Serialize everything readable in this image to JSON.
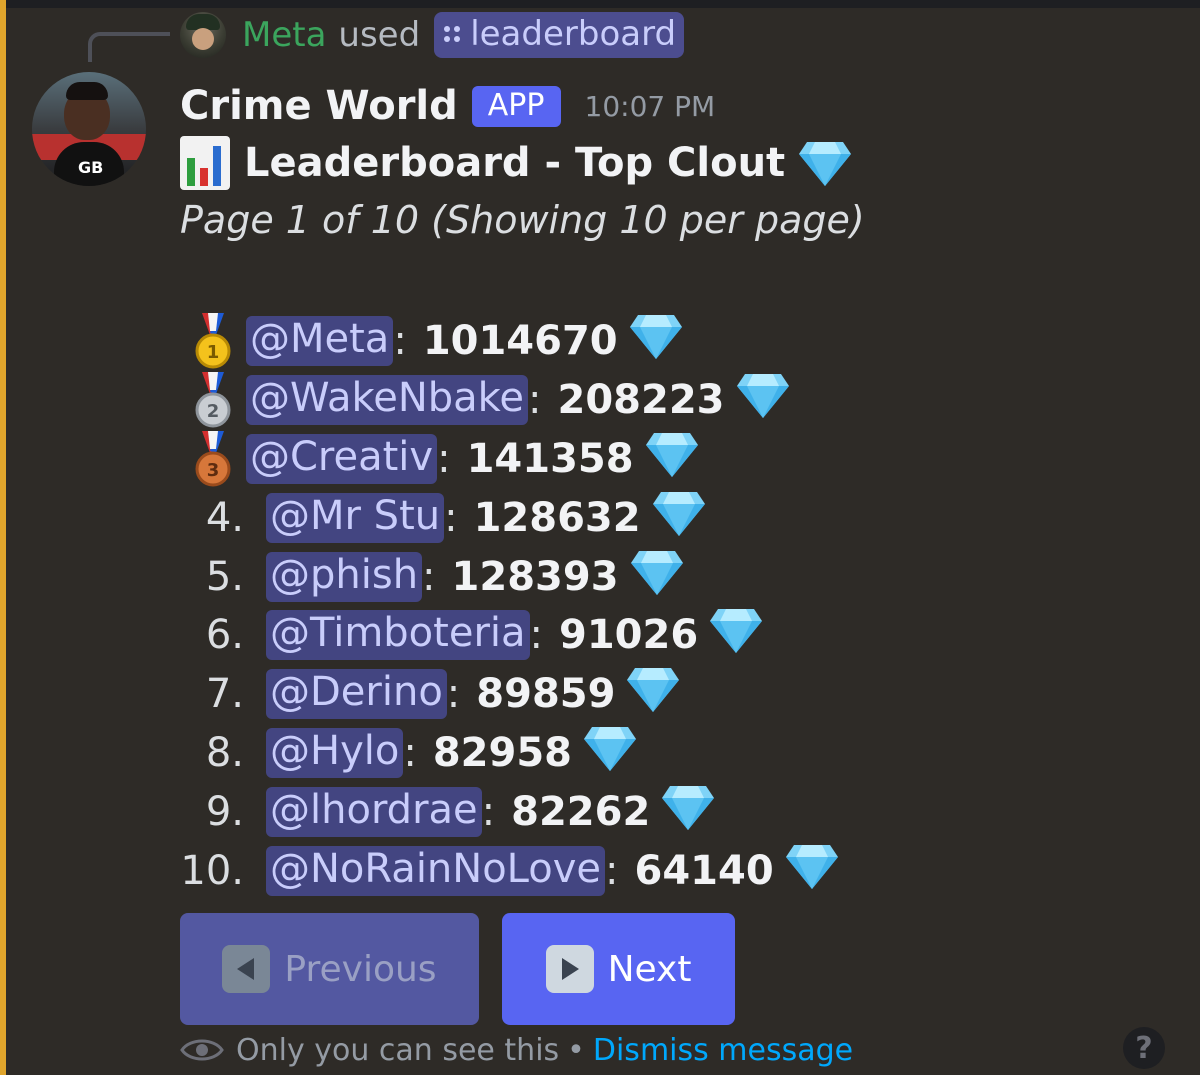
{
  "interaction": {
    "user": "Meta",
    "used_text": "used",
    "command": "leaderboard"
  },
  "message": {
    "author": "Crime World",
    "badge": "APP",
    "timestamp": "10:07 PM",
    "title": "Leaderboard - Top Clout",
    "subtitle": "Page 1 of 10 (Showing 10 per page)"
  },
  "leaderboard": [
    {
      "rank": "1",
      "medal": "gold",
      "mention": "@Meta",
      "score": "1014670"
    },
    {
      "rank": "2",
      "medal": "silver",
      "mention": "@WakeNbake",
      "score": "208223"
    },
    {
      "rank": "3",
      "medal": "bronze",
      "mention": "@Creativ",
      "score": "141358"
    },
    {
      "rank": "4.",
      "medal": "",
      "mention": "@Mr Stu",
      "score": "128632"
    },
    {
      "rank": "5.",
      "medal": "",
      "mention": "@phish",
      "score": "128393"
    },
    {
      "rank": "6.",
      "medal": "",
      "mention": "@Timboteria",
      "score": "91026"
    },
    {
      "rank": "7.",
      "medal": "",
      "mention": "@Derino",
      "score": "89859"
    },
    {
      "rank": "8.",
      "medal": "",
      "mention": "@Hylo",
      "score": "82958"
    },
    {
      "rank": "9.",
      "medal": "",
      "mention": "@lhordrae",
      "score": "82262"
    },
    {
      "rank": "10.",
      "medal": "",
      "mention": "@NoRainNoLove",
      "score": "64140"
    }
  ],
  "buttons": {
    "previous": "Previous",
    "next": "Next"
  },
  "footer": {
    "visibility": "Only you can see this",
    "separator": "•",
    "dismiss": "Dismiss message"
  },
  "help": "?",
  "colors": {
    "background": "#2e2b27",
    "accent_bar": "#e0a52c",
    "blurple": "#5865f2",
    "mention_bg": "#434581",
    "mention_text": "#c9cdfb",
    "interaction_user": "#3ba55d",
    "link": "#00a8fc"
  },
  "icons": [
    "chart-icon",
    "gem-icon",
    "gold-medal-icon",
    "silver-medal-icon",
    "bronze-medal-icon",
    "play-left-icon",
    "play-right-icon",
    "eye-icon",
    "help-icon",
    "slash-command-icon"
  ]
}
